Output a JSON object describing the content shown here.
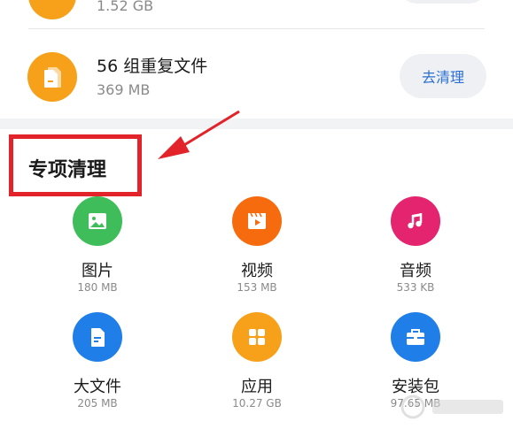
{
  "colors": {
    "accent_blue": "#2b6fd1",
    "orange": "#f7a11a",
    "green": "#3fbd5a",
    "orange_video": "#f76b0f",
    "pink": "#e4246f",
    "blue": "#1f7ee8",
    "orange_app": "#f7a11a",
    "blue_pkg": "#1f7ee8",
    "annotation_red": "#e2232a"
  },
  "top_list": {
    "partial_row": {
      "size": "1.52 GB",
      "icon": "folder-icon"
    },
    "duplicate_row": {
      "title": "56 组重复文件",
      "size": "369 MB",
      "action_label": "去清理",
      "icon": "duplicate-file-icon"
    }
  },
  "special_clean": {
    "title": "专项清理",
    "items": [
      {
        "label": "图片",
        "size": "180 MB",
        "icon": "image-icon"
      },
      {
        "label": "视频",
        "size": "153 MB",
        "icon": "video-icon"
      },
      {
        "label": "音频",
        "size": "533 KB",
        "icon": "music-icon"
      },
      {
        "label": "大文件",
        "size": "205 MB",
        "icon": "large-file-icon"
      },
      {
        "label": "应用",
        "size": "10.27 GB",
        "icon": "apps-icon"
      },
      {
        "label": "安装包",
        "size": "97.65 MB",
        "icon": "package-icon"
      }
    ]
  }
}
